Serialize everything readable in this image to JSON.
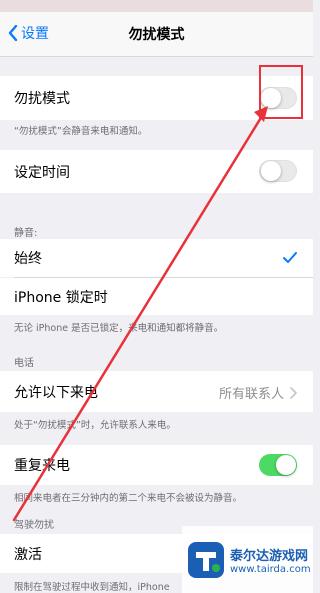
{
  "nav": {
    "back_label": "设置",
    "title": "勿扰模式"
  },
  "dnd": {
    "label": "勿扰模式",
    "on": false,
    "note": "“勿扰模式”会静音来电和通知。"
  },
  "scheduled": {
    "label": "设定时间",
    "on": false
  },
  "silence": {
    "header": "静音:",
    "always_label": "始终",
    "locked_label": "iPhone 锁定时",
    "note": "无论 iPhone 是否已锁定，来电和通知都将静音。"
  },
  "phone": {
    "header": "电话",
    "allow_label": "允许以下来电",
    "allow_value": "所有联系人",
    "allow_note": "处于“勿扰模式”时，允许联系人来电。",
    "repeated_label": "重复来电",
    "repeated_on": true,
    "repeated_note": "相同来电者在三分钟内的第二个来电不会被设为静音。"
  },
  "driving": {
    "header": "驾驶勿扰",
    "activate_label": "激活",
    "note": "限制在驾驶过程中收到通知，iPhone"
  },
  "watermark": {
    "name": "泰尔达游戏网",
    "url": "www.tairda.com"
  },
  "colors": {
    "accent": "#0a7aff",
    "toggle_on": "#4cd964",
    "annotation": "#e8313a"
  }
}
